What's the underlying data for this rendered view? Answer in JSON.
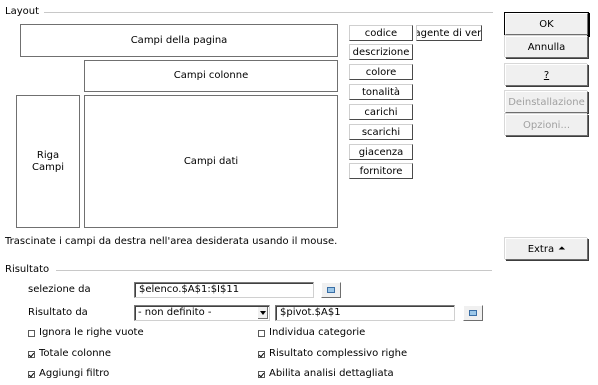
{
  "layout_group": {
    "title": "Layout",
    "page_fields_zone": "Campi della pagina",
    "column_fields_zone": "Campi colonne",
    "row_fields_zone": [
      "Riga",
      "Campi"
    ],
    "data_fields_zone": "Campi dati",
    "hint": "Trascinate i campi da destra nell'area desiderata usando il mouse."
  },
  "fields": [
    {
      "label": "codice"
    },
    {
      "label": "agente di ven"
    },
    {
      "label": "descrizione"
    },
    {
      "label": "colore"
    },
    {
      "label": "tonalità"
    },
    {
      "label": "carichi"
    },
    {
      "label": "scarichi"
    },
    {
      "label": "giacenza"
    },
    {
      "label": "fornitore"
    }
  ],
  "buttons": {
    "ok": "OK",
    "cancel": "Annulla",
    "help": "?",
    "uninstall": "Deinstallazione",
    "options": "Opzioni...",
    "extra": "Extra"
  },
  "result_group": {
    "title": "Risultato",
    "selection_label": "selezione da",
    "selection_value": "$elenco.$A$1:$I$11",
    "result_label": "Risultato da",
    "result_select": "- non definito -",
    "result_target": "$pivot.$A$1"
  },
  "options": [
    {
      "label": "Ignora le righe vuote",
      "checked": false
    },
    {
      "label": "Individua categorie",
      "checked": false
    },
    {
      "label": "Totale colonne",
      "checked": true
    },
    {
      "label": "Risultato complessivo righe",
      "checked": true
    },
    {
      "label": "Aggiungi filtro",
      "checked": true
    },
    {
      "label": "Abilita analisi dettagliata",
      "checked": true
    }
  ]
}
